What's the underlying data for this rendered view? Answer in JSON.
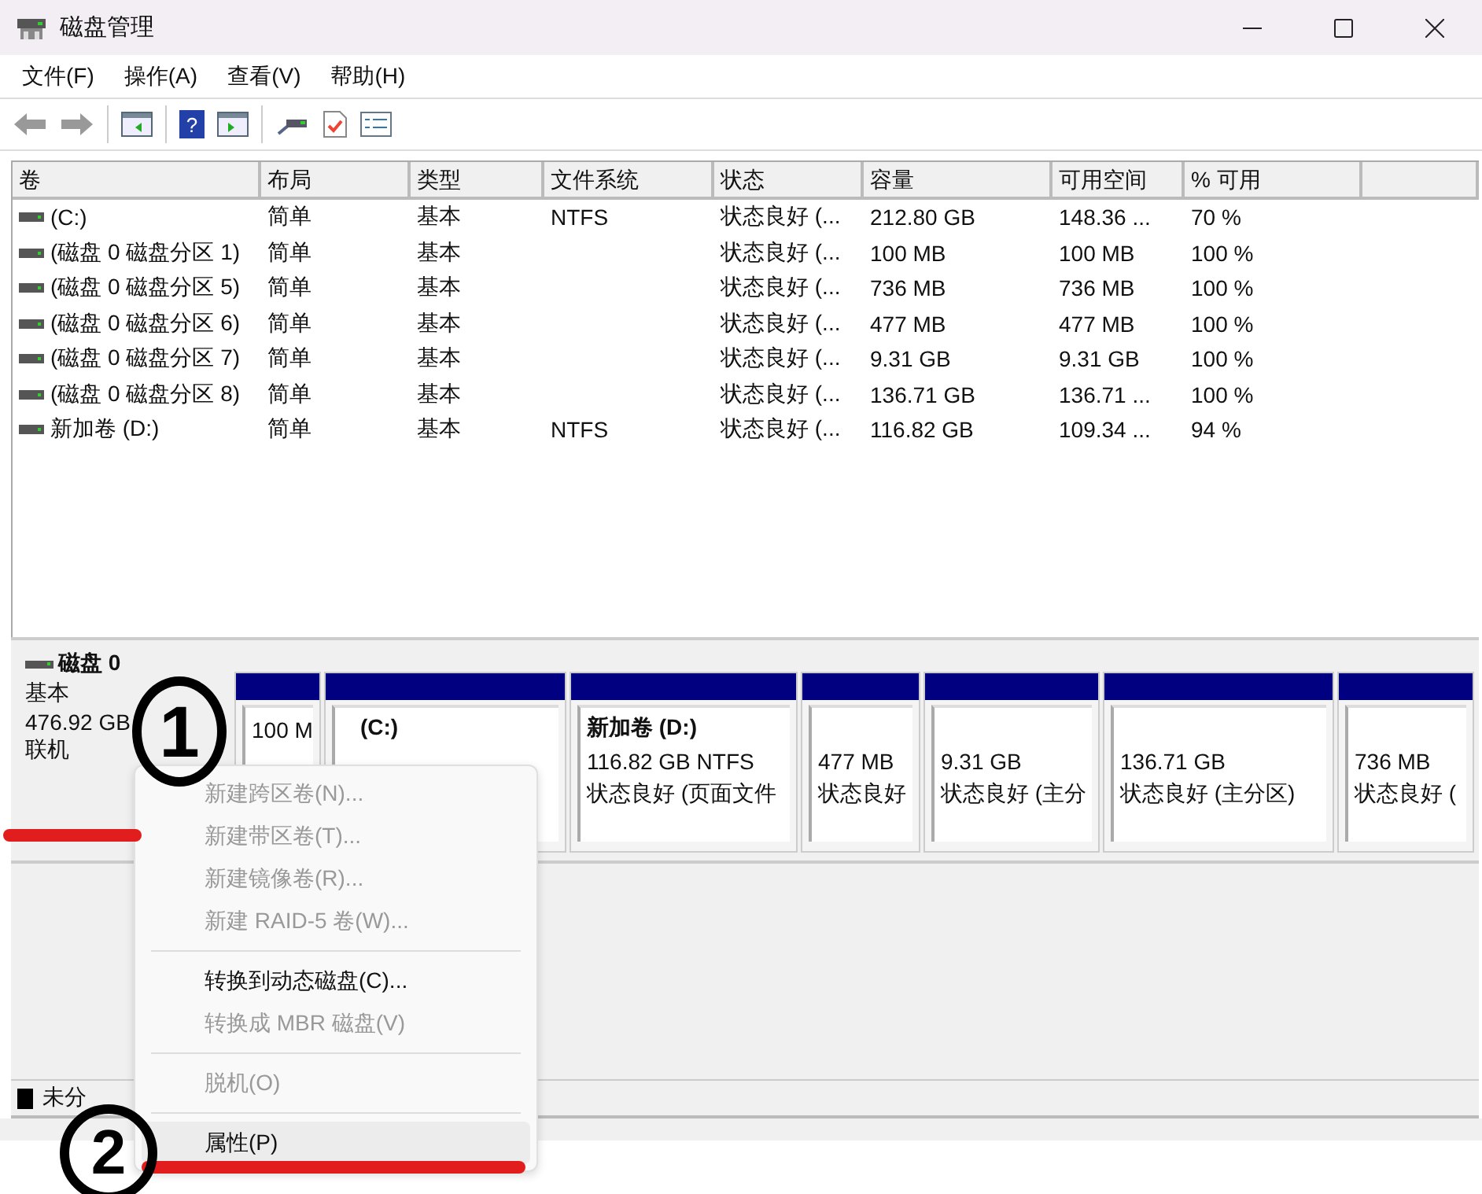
{
  "window": {
    "title": "磁盘管理"
  },
  "menu_bar": [
    "文件(F)",
    "操作(A)",
    "查看(V)",
    "帮助(H)"
  ],
  "table": {
    "columns": [
      "卷",
      "布局",
      "类型",
      "文件系统",
      "状态",
      "容量",
      "可用空间",
      "% 可用"
    ],
    "rows": [
      [
        "(C:)",
        "简单",
        "基本",
        "NTFS",
        "状态良好 (...",
        "212.80 GB",
        "148.36 ...",
        "70 %"
      ],
      [
        "(磁盘 0 磁盘分区 1)",
        "简单",
        "基本",
        "",
        "状态良好 (...",
        "100 MB",
        "100 MB",
        "100 %"
      ],
      [
        "(磁盘 0 磁盘分区 5)",
        "简单",
        "基本",
        "",
        "状态良好 (...",
        "736 MB",
        "736 MB",
        "100 %"
      ],
      [
        "(磁盘 0 磁盘分区 6)",
        "简单",
        "基本",
        "",
        "状态良好 (...",
        "477 MB",
        "477 MB",
        "100 %"
      ],
      [
        "(磁盘 0 磁盘分区 7)",
        "简单",
        "基本",
        "",
        "状态良好 (...",
        "9.31 GB",
        "9.31 GB",
        "100 %"
      ],
      [
        "(磁盘 0 磁盘分区 8)",
        "简单",
        "基本",
        "",
        "状态良好 (...",
        "136.71 GB",
        "136.71 ...",
        "100 %"
      ],
      [
        "新加卷 (D:)",
        "简单",
        "基本",
        "NTFS",
        "状态良好 (...",
        "116.82 GB",
        "109.34 ...",
        "94 %"
      ]
    ]
  },
  "disk": {
    "name": "磁盘 0",
    "type": "基本",
    "size": "476.92 GB",
    "status": "联机",
    "partitions": [
      {
        "size": "100 M"
      },
      {
        "label": "(C:)"
      },
      {
        "label": "新加卷 (D:)",
        "size": "116.82 GB NTFS",
        "status": "状态良好 (页面文件"
      },
      {
        "size": "477 MB",
        "status": "状态良好"
      },
      {
        "size": "9.31 GB",
        "status": "状态良好 (主分"
      },
      {
        "size": "136.71 GB",
        "status": "状态良好 (主分区)"
      },
      {
        "size": "736 MB",
        "status": "状态良好 ("
      }
    ]
  },
  "legend": [
    {
      "label": "未分",
      "color": "#000000"
    }
  ],
  "toolbar": {
    "help_glyph": "?"
  },
  "context_menu": [
    {
      "kind": "item",
      "label": "新建跨区卷(N)...",
      "disabled": true,
      "selected": false
    },
    {
      "kind": "item",
      "label": "新建带区卷(T)...",
      "disabled": true,
      "selected": false
    },
    {
      "kind": "item",
      "label": "新建镜像卷(R)...",
      "disabled": true,
      "selected": false
    },
    {
      "kind": "item",
      "label": "新建 RAID-5 卷(W)...",
      "disabled": true,
      "selected": false
    },
    {
      "kind": "separator"
    },
    {
      "kind": "item",
      "label": "转换到动态磁盘(C)...",
      "disabled": false,
      "selected": false
    },
    {
      "kind": "item",
      "label": "转换成 MBR 磁盘(V)",
      "disabled": true,
      "selected": false
    },
    {
      "kind": "separator"
    },
    {
      "kind": "item",
      "label": "脱机(O)",
      "disabled": true,
      "selected": false
    },
    {
      "kind": "separator"
    },
    {
      "kind": "item",
      "label": "属性(P)",
      "disabled": false,
      "selected": true
    }
  ],
  "annotations": [
    "1",
    "2"
  ]
}
